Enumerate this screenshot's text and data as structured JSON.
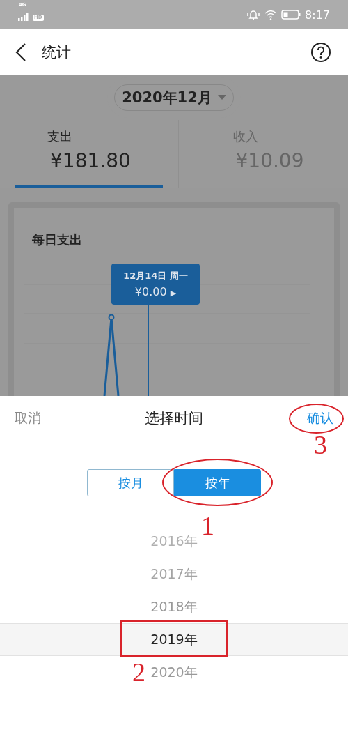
{
  "status_bar": {
    "network": "4G",
    "hd": "HD",
    "time": "8:17"
  },
  "header": {
    "title": "统计"
  },
  "period": {
    "label": "2020年12月"
  },
  "tabs": [
    {
      "label": "支出",
      "amount": "¥181.80",
      "selected": true
    },
    {
      "label": "收入",
      "amount": "¥10.09",
      "selected": false
    }
  ],
  "chart_card": {
    "title": "每日支出",
    "tooltip": {
      "date": "12月14日 周一",
      "value": "¥0.00",
      "arrow": "▶"
    }
  },
  "sheet": {
    "cancel": "取消",
    "title": "选择时间",
    "confirm": {
      "label": "确认",
      "annotation": {
        "kind": "ellipse",
        "step": "3"
      }
    },
    "modes": [
      {
        "label": "按月",
        "selected": false
      },
      {
        "label": "按年",
        "selected": true,
        "annotation": {
          "kind": "ellipse",
          "step": "1"
        }
      }
    ],
    "years": [
      {
        "label": "2016年",
        "selected": false
      },
      {
        "label": "2017年",
        "selected": false
      },
      {
        "label": "2018年",
        "selected": false
      },
      {
        "label": "2019年",
        "selected": true,
        "annotation": {
          "kind": "frame",
          "step": "2"
        }
      },
      {
        "label": "2020年",
        "selected": false
      }
    ]
  }
}
